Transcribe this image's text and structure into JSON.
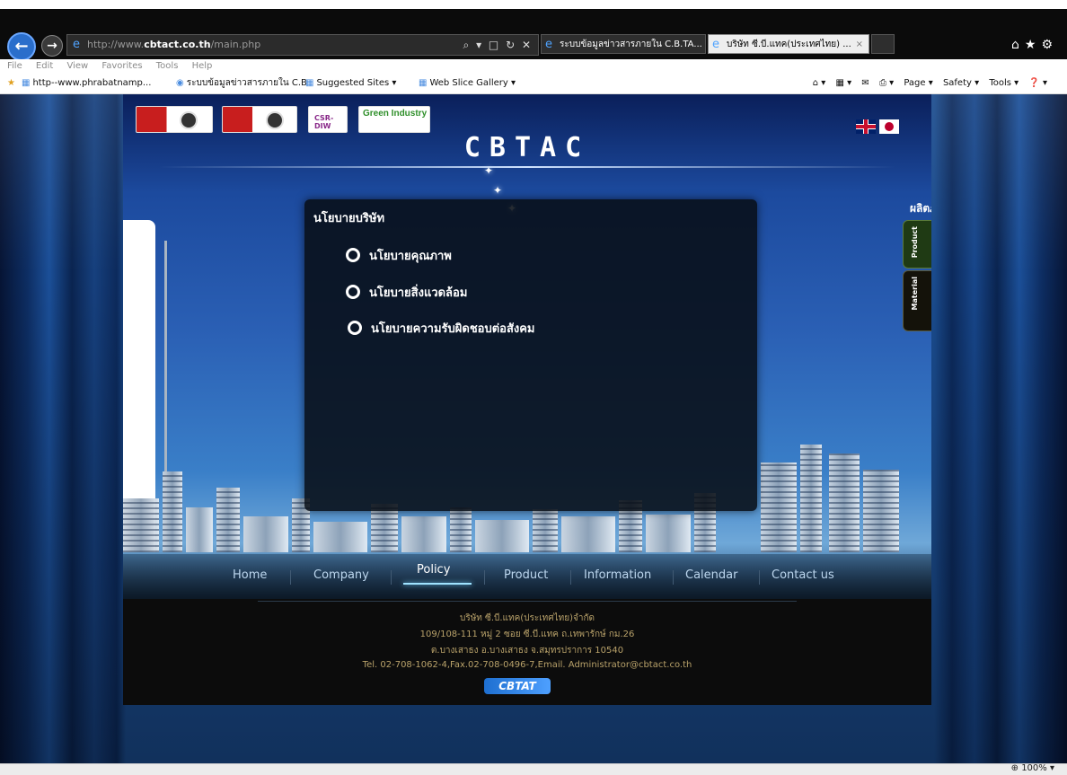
{
  "browser": {
    "address_prefix": "http://www.",
    "address_domain": "cbtact.co.th",
    "address_path": "/main.php",
    "address_tools": "⌕ ▾ □ ↻ ✕",
    "tabs": [
      {
        "label": "ระบบข้อมูลข่าวสารภายใน C.B.TA..."
      },
      {
        "label": "บริษัท ซี.บี.แทค(ประเทศไทย) ...",
        "close": "×"
      }
    ],
    "right_icons": "⌂★⚙",
    "menu": [
      "File",
      "Edit",
      "View",
      "Favorites",
      "Tools",
      "Help"
    ],
    "favorites": [
      {
        "label": "http--www.phrabatnamp..."
      },
      {
        "label": "ระบบข้อมูลข่าวสารภายใน C.B"
      },
      {
        "label": "Suggested Sites ▾"
      },
      {
        "label": "Web Slice Gallery ▾"
      }
    ],
    "command_bar": [
      "⌂ ▾",
      "▦ ▾",
      "✉",
      "⎙ ▾",
      "Page ▾",
      "Safety ▾",
      "Tools ▾",
      "❓ ▾"
    ],
    "zoom": "⊕ 100%  ▾"
  },
  "site": {
    "title": "CBTAC",
    "certs": [
      {
        "label": "certification logo 1"
      },
      {
        "label": "certification logo 2"
      },
      {
        "label": "CSR-DIW"
      },
      {
        "label": "Green Industry"
      }
    ],
    "green_industry": "Green Industry",
    "csr_label": "CSR-DIW",
    "product_label": "ผลิตภั",
    "side_tabs": [
      "Product",
      "Material"
    ],
    "policy": {
      "heading": "นโยบายบริษัท",
      "items": [
        "นโยบายคุณภาพ",
        "นโยบายสิ่งแวดล้อม",
        "นโยบายความรับผิดชอบต่อสังคม"
      ]
    },
    "nav": [
      "Home",
      "Company",
      "Policy",
      "Product",
      "Information",
      "Calendar",
      "Contact us"
    ],
    "footer": {
      "line1": "บริษัท ซี.บี.แทค(ประเทศไทย)จำกัด",
      "line2": "109/108-111 หมู่ 2 ซอย ซี.บี.แทค ถ.เทพารักษ์ กม.26",
      "line3": "ต.บางเสาธง อ.บางเสาธง จ.สมุทรปราการ 10540",
      "line4": "Tel. 02-708-1062-4,Fax.02-708-0496-7,Email. Administrator@cbtact.co.th",
      "logo": "CBTAT"
    }
  },
  "colors": {
    "chrome_dark": "#0b0b0b",
    "nav_text": "#bcd6ee",
    "footer_text": "#b9a26a",
    "panel_bg": "#080e16"
  }
}
